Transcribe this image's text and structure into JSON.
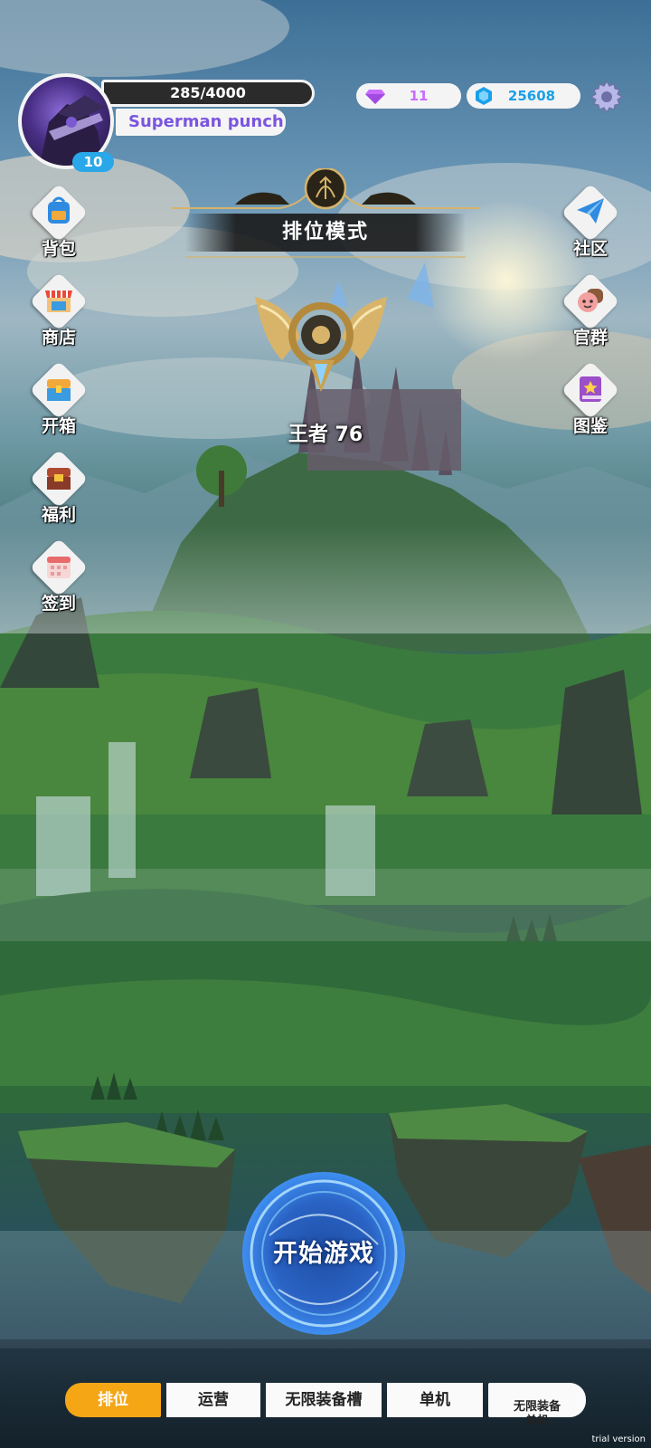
{
  "player": {
    "name": "Superman punch",
    "level": "10",
    "xp": "285/4000"
  },
  "currency": {
    "gems": "11",
    "crystals": "25608"
  },
  "left_menu": [
    {
      "label": "背包",
      "icon": "backpack-icon"
    },
    {
      "label": "商店",
      "icon": "shop-icon"
    },
    {
      "label": "开箱",
      "icon": "chest-icon"
    },
    {
      "label": "福利",
      "icon": "gift-chest-icon"
    },
    {
      "label": "签到",
      "icon": "calendar-icon"
    }
  ],
  "right_menu": [
    {
      "label": "社区",
      "icon": "paper-plane-icon"
    },
    {
      "label": "官群",
      "icon": "group-icon"
    },
    {
      "label": "图鉴",
      "icon": "book-icon"
    }
  ],
  "mode": {
    "title": "排位模式",
    "rank": "王者 76"
  },
  "start_button": "开始游戏",
  "tabs": [
    {
      "label": "排位",
      "active": true
    },
    {
      "label": "运营",
      "active": false
    },
    {
      "label": "无限装备槽",
      "active": false
    },
    {
      "label": "单机",
      "active": false
    },
    {
      "label": "无限装备\n单机",
      "active": false
    }
  ],
  "watermark": "trial version",
  "colors": {
    "accent_orange": "#f4a615",
    "name_purple": "#7b55e0",
    "level_blue": "#29a7e8",
    "gem_purple": "#c86bff",
    "crystal_blue": "#1aa0e8"
  }
}
